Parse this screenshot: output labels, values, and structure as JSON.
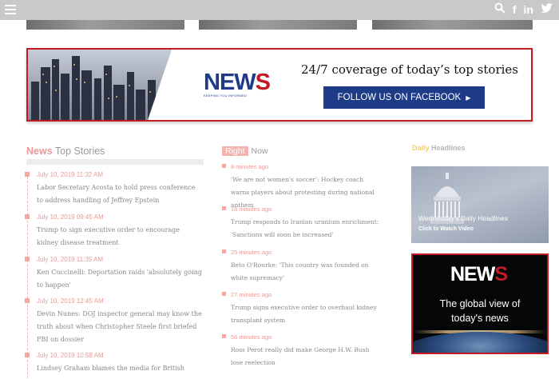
{
  "banner": {
    "logo_primary": "NEW",
    "logo_accent": "S",
    "logo_tagline": "KEEPING YOU INFORMED",
    "headline": "24/7 coverage of today’s top stories",
    "button_label": "FOLLOW US ON FACEBOOK",
    "button_arrow": "▶"
  },
  "top_stories": {
    "title_highlight": "News",
    "title_rest": "Top Stories",
    "items": [
      {
        "time": "July 10, 2019 11:32 AM",
        "text": "Labor Secretary Acosta to hold press conference to address handling of Jeffrey Epstein"
      },
      {
        "time": "July 10, 2019 09:45 AM",
        "text": "Trump to sign executive order to encourage kidney disease treatment"
      },
      {
        "time": "July 10, 2019 11:35 AM",
        "text": "Ken Cuccinelli: Deportation raids 'absolutely going to happen'"
      },
      {
        "time": "July 10, 2019 12:45 AM",
        "text": "Devin Nunes: DOJ inspector general may know the truth about when Christopher Steele first briefed FBI on dossier"
      },
      {
        "time": "July 10, 2019 10:58 AM",
        "text": "Lindsey Graham blames the media for British"
      }
    ]
  },
  "right_now": {
    "badge": "Right",
    "title_rest": "Now",
    "items": [
      {
        "time": "8 minutes ago",
        "text": "'We are not women's soccer': Hockey coach warns players about protesting during national anthem"
      },
      {
        "time": "18 minutes ago",
        "text": "Trump responds to Iranian uranium enrichment: 'Sanctions will soon be increased'"
      },
      {
        "time": "25 minutes ago",
        "text": "Beto O'Rourke: 'This country was founded on white supremacy'"
      },
      {
        "time": "27 minutes ago",
        "text": "Trump signs executive order to overhaul kidney transplant system"
      },
      {
        "time": "56 minutes ago",
        "text": "Ross Perot really did make George H.W. Bush lose reelection"
      }
    ]
  },
  "daily": {
    "title_highlight": "Daily",
    "title_rest": "Headlines",
    "card_title": "Wednesday's Daily Headlines",
    "card_sub": "Click to Watch Video"
  },
  "ad": {
    "logo_primary": "NEW",
    "logo_accent": "S",
    "text_line1": "The global view of",
    "text_line2": "today's news"
  },
  "topbar": {
    "icons": [
      "menu-icon",
      "search-icon",
      "facebook-icon",
      "linkedin-icon",
      "twitter-icon"
    ],
    "facebook_glyph": "f",
    "linkedin_glyph": "in",
    "twitter_glyph": "t"
  },
  "colors": {
    "brand_blue": "#1d3b86",
    "brand_red": "#c21b23",
    "accent_pink": "#e99a95"
  }
}
